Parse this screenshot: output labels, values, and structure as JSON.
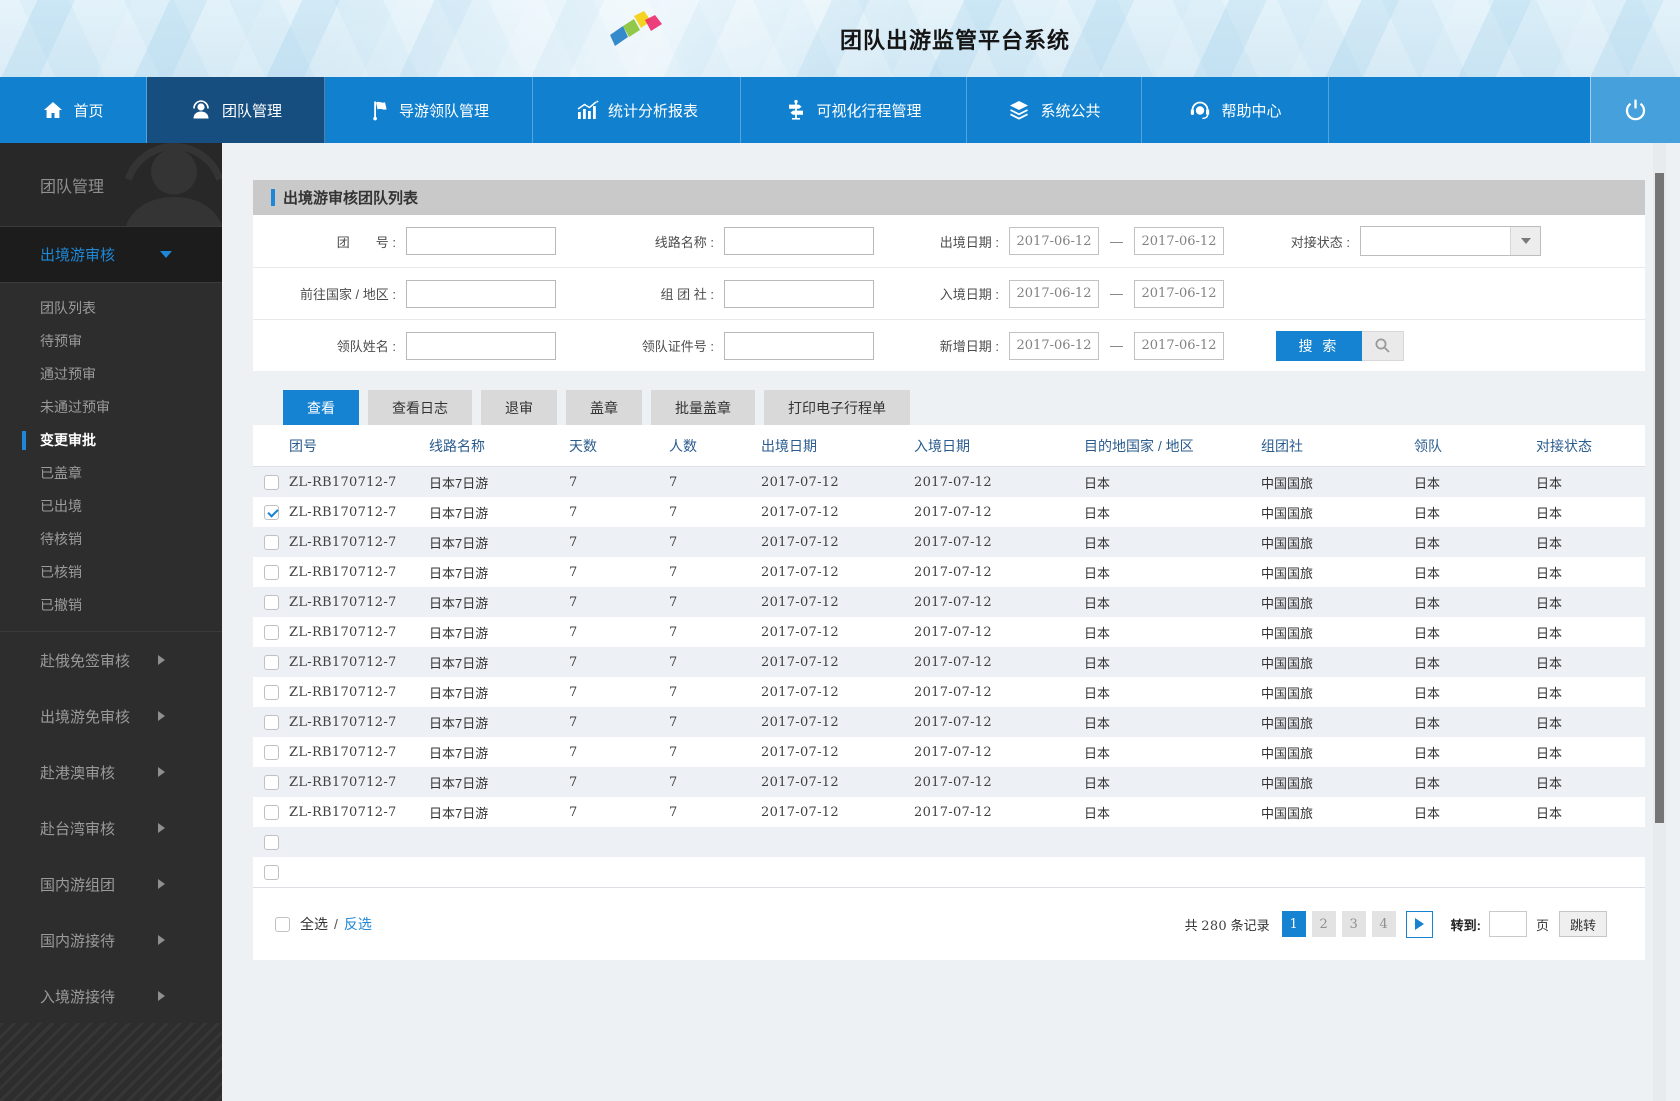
{
  "colors": {
    "accent_blue": "#1583d2",
    "nav_bg": "#1181cf",
    "nav_active_bg": "#164e80",
    "sidebar_link_blue": "#1e87d6",
    "panel_header_gray": "#c9c9c9",
    "row_alt_bg": "#edf0f4",
    "table_header_text": "#2b5c8e"
  },
  "header": {
    "title": "团队出游监管平台系统"
  },
  "nav": {
    "items": [
      {
        "name": "home",
        "label": "首页",
        "icon": "home-icon",
        "active": false
      },
      {
        "name": "team-management",
        "label": "团队管理",
        "icon": "team-icon",
        "active": true
      },
      {
        "name": "guide-leader-management",
        "label": "导游领队管理",
        "icon": "guide-flag-icon",
        "active": false
      },
      {
        "name": "stats-reports",
        "label": "统计分析报表",
        "icon": "stats-chart-icon",
        "active": false
      },
      {
        "name": "itinerary-management",
        "label": "可视化行程管理",
        "icon": "itinerary-signpost-icon",
        "active": false
      },
      {
        "name": "system-public",
        "label": "系统公共",
        "icon": "system-layers-icon",
        "active": false
      },
      {
        "name": "help-center",
        "label": "帮助中心",
        "icon": "help-headset-icon",
        "active": false
      }
    ]
  },
  "sidebar": {
    "section_title": "团队管理",
    "expanded_group": "出境游审核",
    "sub_items": [
      "团队列表",
      "待预审",
      "通过预审",
      "未通过预审",
      "变更审批",
      "已盖章",
      "已出境",
      "待核销",
      "已核销",
      "已撤销"
    ],
    "active_sub_item": "变更审批",
    "collapsed_groups": [
      "赴俄免签审核",
      "出境游免审核",
      "赴港澳审核",
      "赴台湾审核",
      "国内游组团",
      "国内游接待",
      "入境游接待"
    ]
  },
  "panel": {
    "title": "出境游审核团队列表"
  },
  "form": {
    "group_no_label": "团　　号 :",
    "route_name_label": "线路名称 :",
    "depart_date_label": "出境日期 :",
    "depart_from": "2017-06-12",
    "depart_to": "2017-06-12",
    "status_label": "对接状态 :",
    "country_label": "前往国家 / 地区 :",
    "agency_label": "组 团 社 :",
    "entry_date_label": "入境日期 :",
    "entry_from": "2017-06-12",
    "entry_to": "2017-06-12",
    "leader_name_label": "领队姓名 :",
    "leader_id_label": "领队证件号 :",
    "added_date_label": "新增日期 :",
    "added_from": "2017-06-12",
    "added_to": "2017-06-12",
    "dash": "—",
    "search_label": "搜 索"
  },
  "toolbar": {
    "buttons": [
      {
        "label": "查看",
        "active": true
      },
      {
        "label": "查看日志",
        "active": false
      },
      {
        "label": "退审",
        "active": false
      },
      {
        "label": "盖章",
        "active": false
      },
      {
        "label": "批量盖章",
        "active": false
      },
      {
        "label": "打印电子行程单",
        "active": false
      }
    ]
  },
  "table": {
    "columns": [
      "团号",
      "线路名称",
      "天数",
      "人数",
      "出境日期",
      "入境日期",
      "目的地国家 / 地区",
      "组团社",
      "领队",
      "对接状态"
    ],
    "rows": [
      {
        "checked": false,
        "cells": [
          "ZL-RB170712-7",
          "日本7日游",
          "7",
          "7",
          "2017-07-12",
          "2017-07-12",
          "日本",
          "中国国旅",
          "日本",
          "日本"
        ]
      },
      {
        "checked": true,
        "cells": [
          "ZL-RB170712-7",
          "日本7日游",
          "7",
          "7",
          "2017-07-12",
          "2017-07-12",
          "日本",
          "中国国旅",
          "日本",
          "日本"
        ]
      },
      {
        "checked": false,
        "cells": [
          "ZL-RB170712-7",
          "日本7日游",
          "7",
          "7",
          "2017-07-12",
          "2017-07-12",
          "日本",
          "中国国旅",
          "日本",
          "日本"
        ]
      },
      {
        "checked": false,
        "cells": [
          "ZL-RB170712-7",
          "日本7日游",
          "7",
          "7",
          "2017-07-12",
          "2017-07-12",
          "日本",
          "中国国旅",
          "日本",
          "日本"
        ]
      },
      {
        "checked": false,
        "cells": [
          "ZL-RB170712-7",
          "日本7日游",
          "7",
          "7",
          "2017-07-12",
          "2017-07-12",
          "日本",
          "中国国旅",
          "日本",
          "日本"
        ]
      },
      {
        "checked": false,
        "cells": [
          "ZL-RB170712-7",
          "日本7日游",
          "7",
          "7",
          "2017-07-12",
          "2017-07-12",
          "日本",
          "中国国旅",
          "日本",
          "日本"
        ]
      },
      {
        "checked": false,
        "cells": [
          "ZL-RB170712-7",
          "日本7日游",
          "7",
          "7",
          "2017-07-12",
          "2017-07-12",
          "日本",
          "中国国旅",
          "日本",
          "日本"
        ]
      },
      {
        "checked": false,
        "cells": [
          "ZL-RB170712-7",
          "日本7日游",
          "7",
          "7",
          "2017-07-12",
          "2017-07-12",
          "日本",
          "中国国旅",
          "日本",
          "日本"
        ]
      },
      {
        "checked": false,
        "cells": [
          "ZL-RB170712-7",
          "日本7日游",
          "7",
          "7",
          "2017-07-12",
          "2017-07-12",
          "日本",
          "中国国旅",
          "日本",
          "日本"
        ]
      },
      {
        "checked": false,
        "cells": [
          "ZL-RB170712-7",
          "日本7日游",
          "7",
          "7",
          "2017-07-12",
          "2017-07-12",
          "日本",
          "中国国旅",
          "日本",
          "日本"
        ]
      },
      {
        "checked": false,
        "cells": [
          "ZL-RB170712-7",
          "日本7日游",
          "7",
          "7",
          "2017-07-12",
          "2017-07-12",
          "日本",
          "中国国旅",
          "日本",
          "日本"
        ]
      },
      {
        "checked": false,
        "cells": [
          "ZL-RB170712-7",
          "日本7日游",
          "7",
          "7",
          "2017-07-12",
          "2017-07-12",
          "日本",
          "中国国旅",
          "日本",
          "日本"
        ]
      }
    ],
    "empty_row_count": 2
  },
  "footer": {
    "select_all": "全选",
    "slash": "/",
    "invert_select": "反选",
    "total_prefix": "共",
    "total_count": "280",
    "total_suffix": "条记录",
    "pages": [
      "1",
      "2",
      "3",
      "4"
    ],
    "active_page": "1",
    "goto_label": "转到:",
    "goto_value": "",
    "page_word": "页",
    "jump_label": "跳转"
  }
}
